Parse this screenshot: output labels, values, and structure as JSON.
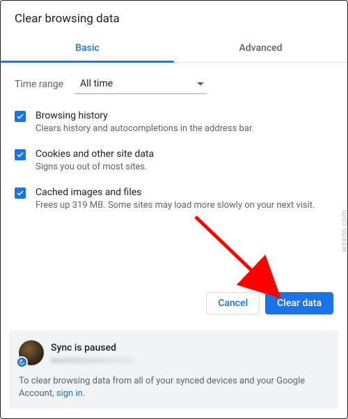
{
  "dialog": {
    "title": "Clear browsing data"
  },
  "tabs": {
    "basic": "Basic",
    "advanced": "Advanced"
  },
  "timerange": {
    "label": "Time range",
    "value": "All time"
  },
  "options": {
    "history": {
      "title": "Browsing history",
      "desc": "Clears history and autocompletions in the address bar."
    },
    "cookies": {
      "title": "Cookies and other site data",
      "desc": "Signs you out of most sites."
    },
    "cache": {
      "title": "Cached images and files",
      "desc": "Frees up 319 MB. Some sites may load more slowly on your next visit."
    }
  },
  "buttons": {
    "cancel": "Cancel",
    "clear": "Clear data"
  },
  "sync": {
    "status": "Sync is paused",
    "hint_prefix": "To clear browsing data from all of your synced devices and your Google Account, ",
    "sign_in": "sign in",
    "hint_suffix": "."
  },
  "watermark": "wsxdn.com",
  "colors": {
    "primary": "#1a73e8",
    "text": "#202124",
    "muted": "#5f6368"
  }
}
